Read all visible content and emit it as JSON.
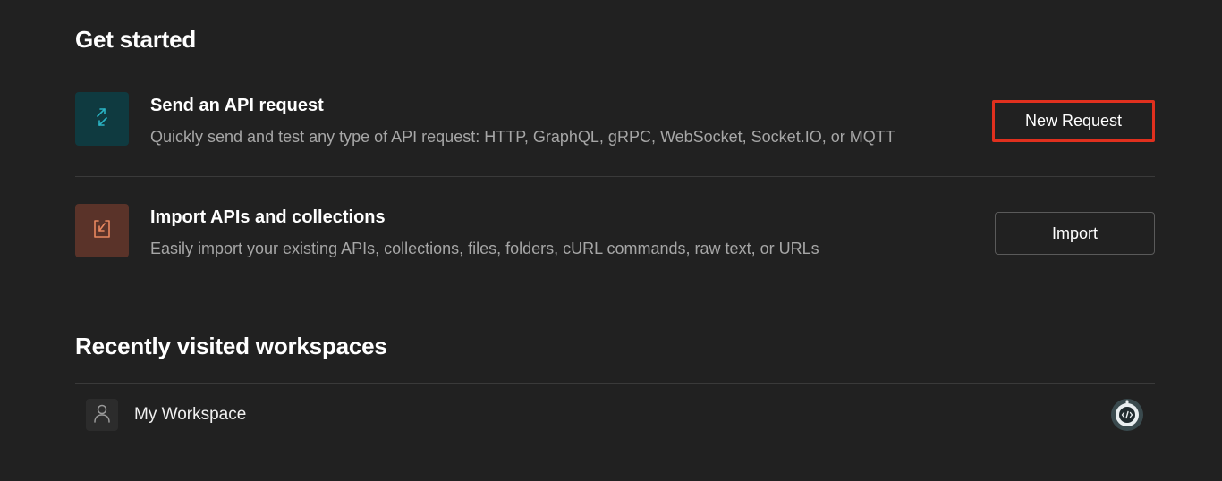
{
  "get_started": {
    "title": "Get started",
    "items": [
      {
        "title": "Send an API request",
        "description": "Quickly send and test any type of API request: HTTP, GraphQL, gRPC, WebSocket, Socket.IO, or MQTT",
        "button_label": "New Request",
        "icon": "api-request-arrows-icon",
        "tile_color": "#0f3a40",
        "icon_color": "#2ab3c4"
      },
      {
        "title": "Import APIs and collections",
        "description": "Easily import your existing APIs, collections, files, folders, cURL commands, raw text, or URLs",
        "button_label": "Import",
        "icon": "import-icon",
        "tile_color": "#5a3329",
        "icon_color": "#e8875f"
      }
    ]
  },
  "recent_workspaces": {
    "title": "Recently visited workspaces",
    "items": [
      {
        "name": "My Workspace",
        "icon": "person-icon",
        "badge_icon": "code-robot-icon"
      }
    ]
  },
  "colors": {
    "background": "#212121",
    "highlight_border": "#e0301e",
    "muted_text": "#a6a6a6"
  }
}
